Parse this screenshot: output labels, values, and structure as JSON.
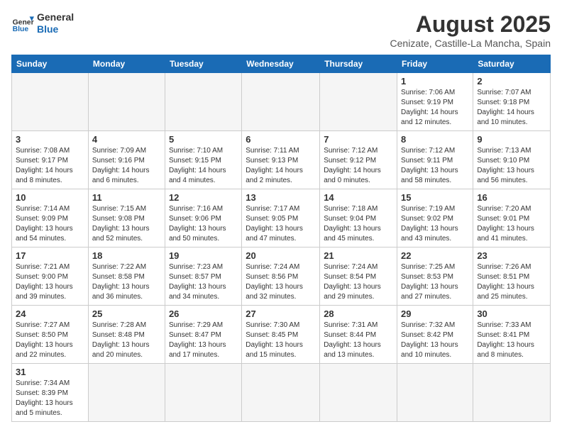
{
  "header": {
    "logo_general": "General",
    "logo_blue": "Blue",
    "month_title": "August 2025",
    "location": "Cenizate, Castille-La Mancha, Spain"
  },
  "weekdays": [
    "Sunday",
    "Monday",
    "Tuesday",
    "Wednesday",
    "Thursday",
    "Friday",
    "Saturday"
  ],
  "weeks": [
    [
      {
        "day": "",
        "info": ""
      },
      {
        "day": "",
        "info": ""
      },
      {
        "day": "",
        "info": ""
      },
      {
        "day": "",
        "info": ""
      },
      {
        "day": "",
        "info": ""
      },
      {
        "day": "1",
        "info": "Sunrise: 7:06 AM\nSunset: 9:19 PM\nDaylight: 14 hours and 12 minutes."
      },
      {
        "day": "2",
        "info": "Sunrise: 7:07 AM\nSunset: 9:18 PM\nDaylight: 14 hours and 10 minutes."
      }
    ],
    [
      {
        "day": "3",
        "info": "Sunrise: 7:08 AM\nSunset: 9:17 PM\nDaylight: 14 hours and 8 minutes."
      },
      {
        "day": "4",
        "info": "Sunrise: 7:09 AM\nSunset: 9:16 PM\nDaylight: 14 hours and 6 minutes."
      },
      {
        "day": "5",
        "info": "Sunrise: 7:10 AM\nSunset: 9:15 PM\nDaylight: 14 hours and 4 minutes."
      },
      {
        "day": "6",
        "info": "Sunrise: 7:11 AM\nSunset: 9:13 PM\nDaylight: 14 hours and 2 minutes."
      },
      {
        "day": "7",
        "info": "Sunrise: 7:12 AM\nSunset: 9:12 PM\nDaylight: 14 hours and 0 minutes."
      },
      {
        "day": "8",
        "info": "Sunrise: 7:12 AM\nSunset: 9:11 PM\nDaylight: 13 hours and 58 minutes."
      },
      {
        "day": "9",
        "info": "Sunrise: 7:13 AM\nSunset: 9:10 PM\nDaylight: 13 hours and 56 minutes."
      }
    ],
    [
      {
        "day": "10",
        "info": "Sunrise: 7:14 AM\nSunset: 9:09 PM\nDaylight: 13 hours and 54 minutes."
      },
      {
        "day": "11",
        "info": "Sunrise: 7:15 AM\nSunset: 9:08 PM\nDaylight: 13 hours and 52 minutes."
      },
      {
        "day": "12",
        "info": "Sunrise: 7:16 AM\nSunset: 9:06 PM\nDaylight: 13 hours and 50 minutes."
      },
      {
        "day": "13",
        "info": "Sunrise: 7:17 AM\nSunset: 9:05 PM\nDaylight: 13 hours and 47 minutes."
      },
      {
        "day": "14",
        "info": "Sunrise: 7:18 AM\nSunset: 9:04 PM\nDaylight: 13 hours and 45 minutes."
      },
      {
        "day": "15",
        "info": "Sunrise: 7:19 AM\nSunset: 9:02 PM\nDaylight: 13 hours and 43 minutes."
      },
      {
        "day": "16",
        "info": "Sunrise: 7:20 AM\nSunset: 9:01 PM\nDaylight: 13 hours and 41 minutes."
      }
    ],
    [
      {
        "day": "17",
        "info": "Sunrise: 7:21 AM\nSunset: 9:00 PM\nDaylight: 13 hours and 39 minutes."
      },
      {
        "day": "18",
        "info": "Sunrise: 7:22 AM\nSunset: 8:58 PM\nDaylight: 13 hours and 36 minutes."
      },
      {
        "day": "19",
        "info": "Sunrise: 7:23 AM\nSunset: 8:57 PM\nDaylight: 13 hours and 34 minutes."
      },
      {
        "day": "20",
        "info": "Sunrise: 7:24 AM\nSunset: 8:56 PM\nDaylight: 13 hours and 32 minutes."
      },
      {
        "day": "21",
        "info": "Sunrise: 7:24 AM\nSunset: 8:54 PM\nDaylight: 13 hours and 29 minutes."
      },
      {
        "day": "22",
        "info": "Sunrise: 7:25 AM\nSunset: 8:53 PM\nDaylight: 13 hours and 27 minutes."
      },
      {
        "day": "23",
        "info": "Sunrise: 7:26 AM\nSunset: 8:51 PM\nDaylight: 13 hours and 25 minutes."
      }
    ],
    [
      {
        "day": "24",
        "info": "Sunrise: 7:27 AM\nSunset: 8:50 PM\nDaylight: 13 hours and 22 minutes."
      },
      {
        "day": "25",
        "info": "Sunrise: 7:28 AM\nSunset: 8:48 PM\nDaylight: 13 hours and 20 minutes."
      },
      {
        "day": "26",
        "info": "Sunrise: 7:29 AM\nSunset: 8:47 PM\nDaylight: 13 hours and 17 minutes."
      },
      {
        "day": "27",
        "info": "Sunrise: 7:30 AM\nSunset: 8:45 PM\nDaylight: 13 hours and 15 minutes."
      },
      {
        "day": "28",
        "info": "Sunrise: 7:31 AM\nSunset: 8:44 PM\nDaylight: 13 hours and 13 minutes."
      },
      {
        "day": "29",
        "info": "Sunrise: 7:32 AM\nSunset: 8:42 PM\nDaylight: 13 hours and 10 minutes."
      },
      {
        "day": "30",
        "info": "Sunrise: 7:33 AM\nSunset: 8:41 PM\nDaylight: 13 hours and 8 minutes."
      }
    ],
    [
      {
        "day": "31",
        "info": "Sunrise: 7:34 AM\nSunset: 8:39 PM\nDaylight: 13 hours and 5 minutes."
      },
      {
        "day": "",
        "info": ""
      },
      {
        "day": "",
        "info": ""
      },
      {
        "day": "",
        "info": ""
      },
      {
        "day": "",
        "info": ""
      },
      {
        "day": "",
        "info": ""
      },
      {
        "day": "",
        "info": ""
      }
    ]
  ]
}
